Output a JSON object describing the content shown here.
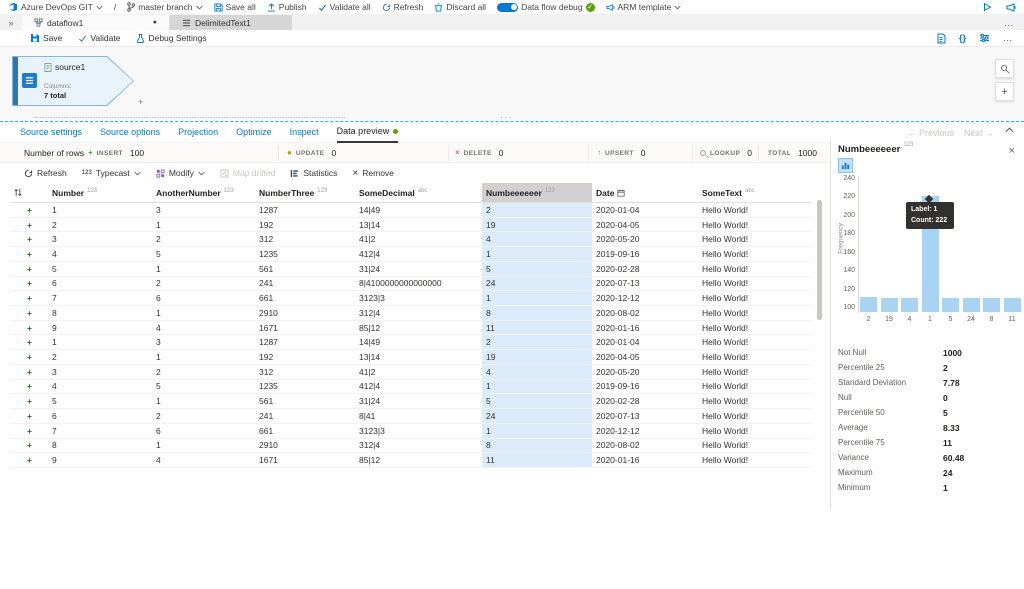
{
  "colors": {
    "accent": "#0078d4",
    "highlight_cell": "#dcebfa",
    "bar_blue": "#a9d3f2",
    "insert_green": "#107c10",
    "update_orange": "#c19c00",
    "delete_red": "#d13438",
    "tooltip_bg": "#323130",
    "active_dot_green": "#5ca300"
  },
  "icons": {
    "expander": "»",
    "more": "…",
    "braces": "{}",
    "slash": "/",
    "prev_arrow": "←",
    "next_arrow": "→",
    "close": "×",
    "plus": "+"
  },
  "top_toolbar": {
    "source_control": "Azure DevOps GIT",
    "branch": "master branch",
    "save_all": "Save all",
    "publish": "Publish",
    "validate_all": "Validate all",
    "refresh": "Refresh",
    "discard_all": "Discard all",
    "debug_toggle_label": "Data flow debug",
    "arm_template": "ARM template"
  },
  "tab_bar": {
    "tabs": [
      {
        "label": "dataflow1",
        "dirty": "●"
      },
      {
        "label": "DelimitedText1",
        "dirty": ""
      }
    ]
  },
  "factory_toolbar": {
    "save": "Save",
    "validate": "Validate",
    "debug_settings": "Debug Settings"
  },
  "canvas": {
    "node_title": "source1",
    "columns_label": "Columns:",
    "columns_value": "7 total"
  },
  "preview": {
    "tabs": [
      "Source settings",
      "Source options",
      "Projection",
      "Optimize",
      "Inspect",
      "Data preview"
    ],
    "active_tab": "Data preview",
    "pager_previous": "← Previous",
    "pager_next": "Next →",
    "rows_label": "Number of rows",
    "metrics": [
      {
        "icon": "plus-icon",
        "label": "INSERT",
        "value": "100"
      },
      {
        "icon": "dot-icon",
        "label": "UPDATE",
        "value": "0"
      },
      {
        "icon": "cross-icon",
        "label": "DELETE",
        "value": "0"
      },
      {
        "icon": "upsert-icon",
        "label": "UPSERT",
        "value": "0"
      },
      {
        "icon": "lookup-icon",
        "label": "LOOKUP",
        "value": "0"
      },
      {
        "icon": "none",
        "label": "TOTAL",
        "value": "1000"
      }
    ],
    "actions": {
      "refresh": "Refresh",
      "typecast": "Typecast",
      "modify": "Modify",
      "map_drifted": "Map drifted",
      "statistics": "Statistics",
      "remove": "Remove"
    },
    "table": {
      "columns": [
        {
          "name": "Number",
          "type": "123"
        },
        {
          "name": "AnotherNumber",
          "type": "123"
        },
        {
          "name": "NumberThree",
          "type": "123"
        },
        {
          "name": "SomeDecimal",
          "type": "abc"
        },
        {
          "name": "Numbeeeeeer",
          "type": "123",
          "selected": true
        },
        {
          "name": "Date",
          "type": "calendar"
        },
        {
          "name": "SomeText",
          "type": "abc"
        }
      ],
      "highlight_column": "Numbeeeeeer",
      "rows": [
        {
          "cells": [
            "1",
            "3",
            "1287",
            "14|49",
            "2",
            "2020-01-04",
            "Hello World!"
          ]
        },
        {
          "cells": [
            "2",
            "1",
            "192",
            "13|14",
            "19",
            "2020-04-05",
            "Hello World!"
          ]
        },
        {
          "cells": [
            "3",
            "2",
            "312",
            "41|2",
            "4",
            "2020-05-20",
            "Hello World!"
          ]
        },
        {
          "cells": [
            "4",
            "5",
            "1235",
            "412|4",
            "1",
            "2019-09-16",
            "Hello World!"
          ]
        },
        {
          "cells": [
            "5",
            "1",
            "561",
            "31|24",
            "5",
            "2020-02-28",
            "Hello World!"
          ]
        },
        {
          "cells": [
            "6",
            "2",
            "241",
            "8|4100000000000000",
            "24",
            "2020-07-13",
            "Hello World!"
          ]
        },
        {
          "cells": [
            "7",
            "6",
            "661",
            "3123|3",
            "1",
            "2020-12-12",
            "Hello World!"
          ]
        },
        {
          "cells": [
            "8",
            "1",
            "2910",
            "312|4",
            "8",
            "2020-08-02",
            "Hello World!"
          ]
        },
        {
          "cells": [
            "9",
            "4",
            "1671",
            "85|12",
            "11",
            "2020-01-16",
            "Hello World!"
          ]
        },
        {
          "cells": [
            "1",
            "3",
            "1287",
            "14|49",
            "2",
            "2020-01-04",
            "Hello World!"
          ]
        },
        {
          "cells": [
            "2",
            "1",
            "192",
            "13|14",
            "19",
            "2020-04-05",
            "Hello World!"
          ]
        },
        {
          "cells": [
            "3",
            "2",
            "312",
            "41|2",
            "4",
            "2020-05-20",
            "Hello World!"
          ]
        },
        {
          "cells": [
            "4",
            "5",
            "1235",
            "412|4",
            "1",
            "2019-09-16",
            "Hello World!"
          ]
        },
        {
          "cells": [
            "5",
            "1",
            "561",
            "31|24",
            "5",
            "2020-02-28",
            "Hello World!"
          ]
        },
        {
          "cells": [
            "6",
            "2",
            "241",
            "8|41",
            "24",
            "2020-07-13",
            "Hello World!"
          ]
        },
        {
          "cells": [
            "7",
            "6",
            "661",
            "3123|3",
            "1",
            "2020-12-12",
            "Hello World!"
          ]
        },
        {
          "cells": [
            "8",
            "1",
            "2910",
            "312|4",
            "8",
            "2020-08-02",
            "Hello World!"
          ]
        },
        {
          "cells": [
            "9",
            "4",
            "1671",
            "85|12",
            "11",
            "2020-01-16",
            "Hello World!"
          ]
        }
      ]
    }
  },
  "stats_panel": {
    "title": "Numbeeeeeer",
    "type_tag": "123",
    "stats": [
      {
        "label": "Not Null",
        "value": "1000"
      },
      {
        "label": "Percentile 25",
        "value": "2"
      },
      {
        "label": "Standard Deviation",
        "value": "7.78"
      },
      {
        "label": "Null",
        "value": "0"
      },
      {
        "label": "Percentile 50",
        "value": "5"
      },
      {
        "label": "Average",
        "value": "8.33"
      },
      {
        "label": "Percentile 75",
        "value": "11"
      },
      {
        "label": "Variance",
        "value": "60.48"
      },
      {
        "label": "Maximum",
        "value": "24"
      },
      {
        "label": "Minimum",
        "value": "1"
      }
    ]
  },
  "chart_data": {
    "type": "bar",
    "title": "Numbeeeeeer",
    "xlabel": "",
    "ylabel": "Frequency",
    "categories": [
      "2",
      "19",
      "4",
      "1",
      "5",
      "24",
      "8",
      "11"
    ],
    "values": [
      112,
      111,
      111,
      222,
      111,
      111,
      111,
      111
    ],
    "ylim": [
      100,
      240
    ],
    "yticks": [
      240,
      220,
      200,
      180,
      160,
      140,
      120,
      100
    ],
    "grid": false,
    "legend": false,
    "highlight_index": 3,
    "tooltip": {
      "line1": "Label: 1",
      "line2": "Count: 222"
    }
  }
}
